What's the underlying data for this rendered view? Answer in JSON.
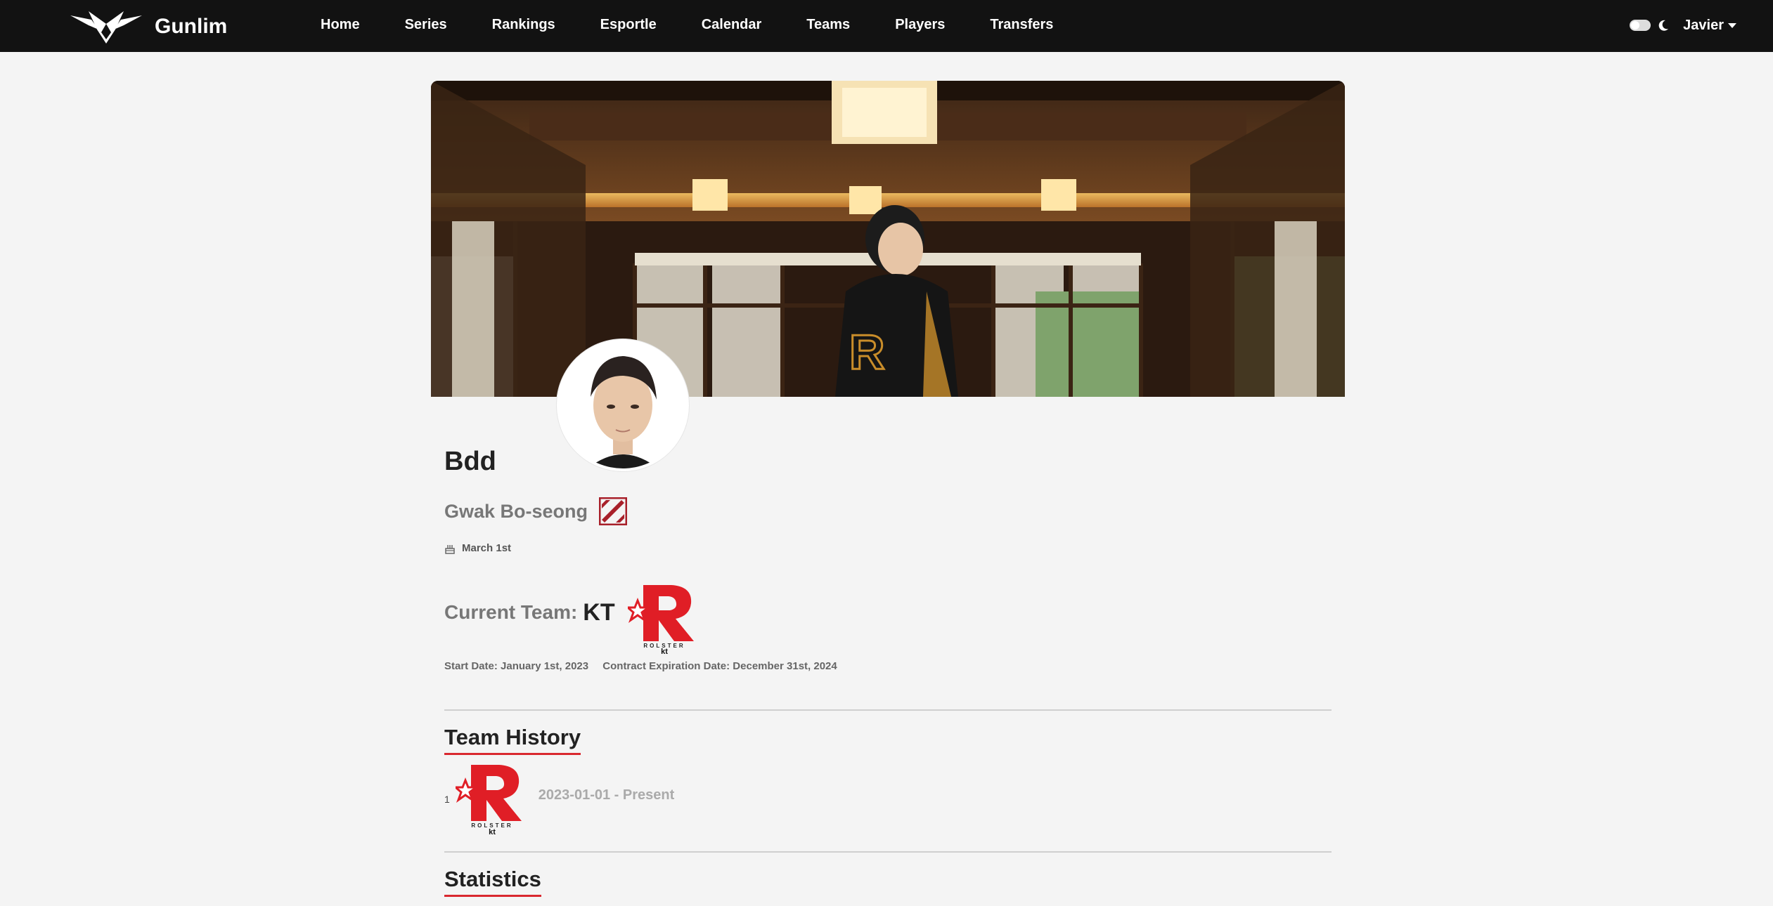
{
  "nav": {
    "brand": "Gunlim",
    "links": [
      "Home",
      "Series",
      "Rankings",
      "Esportle",
      "Calendar",
      "Teams",
      "Players",
      "Transfers"
    ],
    "user": "Javier"
  },
  "player": {
    "nickname": "Bdd",
    "real_name": "Gwak Bo-seong",
    "birthday": "March 1st",
    "current_team_label": "Current Team:",
    "current_team": "KT",
    "start_date": "Start Date: January 1st, 2023",
    "contract_expiration": "Contract Expiration Date: December 31st, 2024"
  },
  "team_logo": {
    "text": "ROLSTER",
    "sub": "kt",
    "color": "#e01e26"
  },
  "team_history": {
    "title": "Team History",
    "rows": [
      {
        "index": "1",
        "dates": "2023-01-01 - Present"
      }
    ]
  },
  "statistics": {
    "title": "Statistics"
  },
  "icons": {
    "brand": "gunlim-logo-icon",
    "theme_toggle": "toggle-icon",
    "theme": "moon-icon",
    "birthday": "cake-icon",
    "nationality": "korea-flag-icon"
  }
}
